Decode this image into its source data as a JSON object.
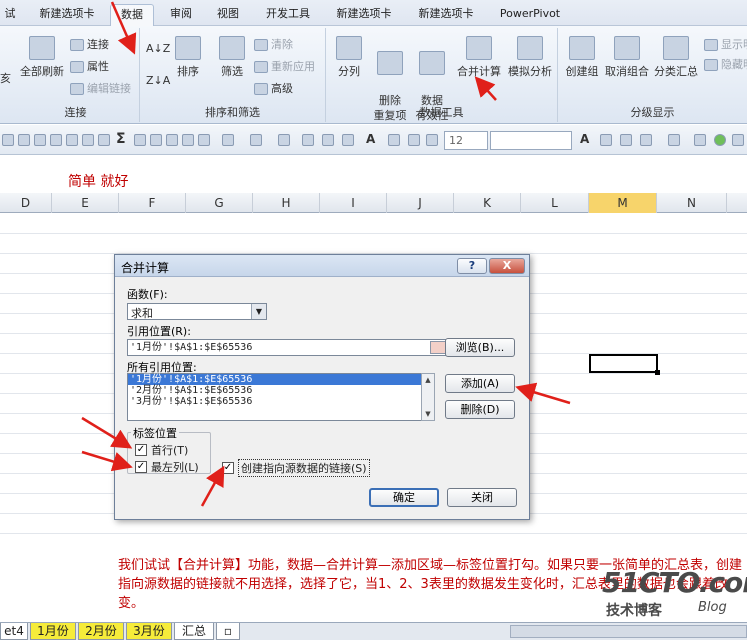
{
  "ribbon_tabs": [
    "试",
    "新建选项卡",
    "数据",
    "审阅",
    "视图",
    "开发工具",
    "新建选项卡",
    "新建选项卡",
    "PowerPivot"
  ],
  "ribbon": {
    "groups": {
      "connections": "连接",
      "sort_filter": "排序和筛选",
      "data_tools": "数据工具",
      "outline": "分级显示"
    },
    "buttons": {
      "refresh_all": "全部刷新",
      "connections": "连接",
      "properties": "属性",
      "edit_links": "编辑链接",
      "sort": "排序",
      "filter": "筛选",
      "clear": "清除",
      "reapply": "重新应用",
      "advanced": "高级",
      "text_to_columns": "分列",
      "remove_duplicates": "删除\n重复项",
      "data_validation": "数据\n有效性",
      "consolidate": "合并计算",
      "what_if": "模拟分析",
      "group": "创建组",
      "ungroup": "取消组合",
      "subtotal": "分类汇总",
      "show_detail": "显示明",
      "hide_detail": "隐藏明"
    },
    "partial_left": "亥"
  },
  "toolbar": {
    "font_size": "12"
  },
  "sheet": {
    "note": "简单 就好",
    "columns": [
      "D",
      "E",
      "F",
      "G",
      "H",
      "I",
      "J",
      "K",
      "L",
      "M",
      "N"
    ],
    "selected_column": "M",
    "caption": "我们试试【合并计算】功能，数据—合并计算—添加区域—标签位置打勾。如果只要一张简单的汇总表，创建指向源数据的链接就不用选择，选择了它，当1、2、3表里的数据发生变化时，汇总表里的数据也会跟着改变。",
    "tabs": [
      "et4",
      "1月份",
      "2月份",
      "3月份",
      "汇总"
    ]
  },
  "dialog": {
    "title": "合并计算",
    "help": "?",
    "close": "X",
    "function_label": "函数(F):",
    "function_value": "求和",
    "reference_label": "引用位置(R):",
    "reference_value": "'1月份'!$A$1:$E$65536",
    "browse": "浏览(B)...",
    "all_refs_label": "所有引用位置:",
    "all_refs": [
      "'1月份'!$A$1:$E$65536",
      "'2月份'!$A$1:$E$65536",
      "'3月份'!$A$1:$E$65536"
    ],
    "add": "添加(A)",
    "delete": "删除(D)",
    "labels_group": "标签位置",
    "top_row": "首行(T)",
    "left_column": "最左列(L)",
    "create_links": "创建指向源数据的链接(S)",
    "ok": "确定",
    "close_button": "关闭"
  },
  "watermark": {
    "main": "51CTO.com",
    "sub": "技术博客",
    "blog": "Blog"
  },
  "colors": {
    "arrow": "#e0201a",
    "caption": "#c00000",
    "selected_col": "#f7d46b",
    "tab_yellow": "#f6ec3a"
  }
}
